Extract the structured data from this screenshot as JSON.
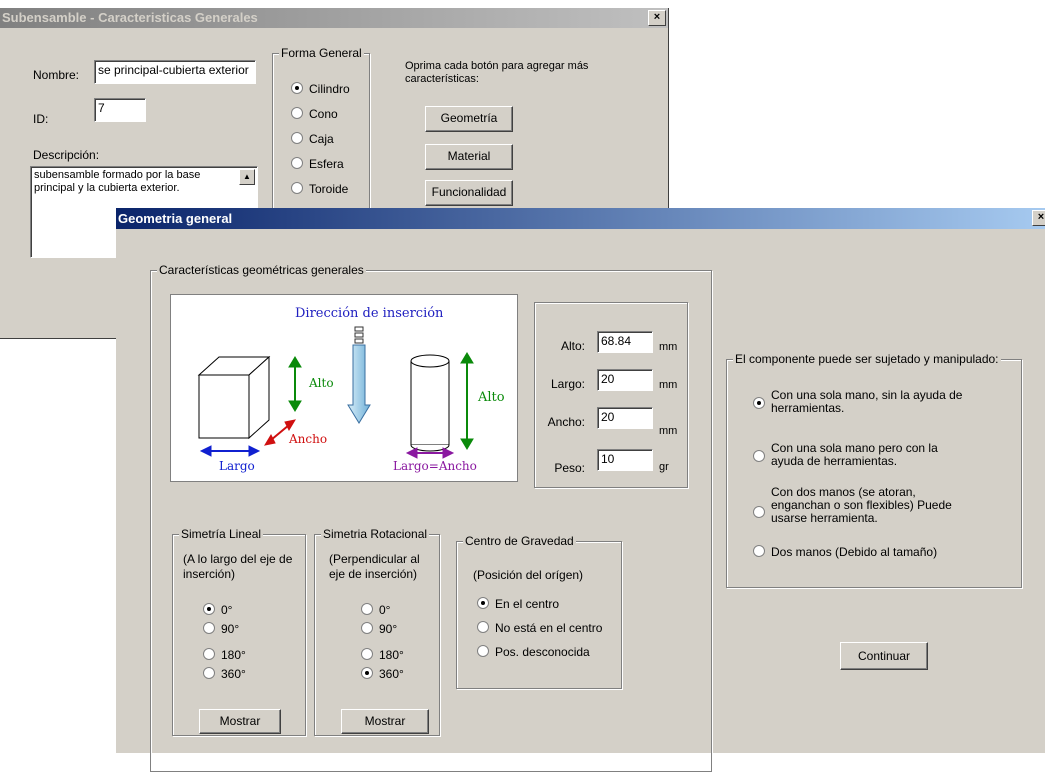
{
  "win1": {
    "title": "Subensamble - Caracteristicas Generales",
    "close": "×",
    "nombre_label": "Nombre:",
    "nombre_value": "se principal-cubierta exterior",
    "id_label": "ID:",
    "id_value": "7",
    "desc_label": "Descripción:",
    "desc_value": "subensamble formado por la base principal y la cubierta exterior.",
    "forma_legend": "Forma General",
    "forma_options": [
      "Cilindro",
      "Cono",
      "Caja",
      "Esfera",
      "Toroide"
    ],
    "hint": "Oprima cada botón para agregar más características:",
    "buttons": [
      "Geometría",
      "Material",
      "Funcionalidad"
    ]
  },
  "win2": {
    "title": "Geometria general",
    "close": "×",
    "caract_legend": "Características geométricas generales",
    "diagram": {
      "direccion": "Dirección de inserción",
      "alto1": "Alto",
      "ancho": "Ancho",
      "largo": "Largo",
      "alto2": "Alto",
      "largo_ancho": "Largo=Ancho"
    },
    "dims": {
      "alto_label": "Alto:",
      "alto_value": "68.84",
      "alto_unit": "mm",
      "largo_label": "Largo:",
      "largo_value": "20",
      "largo_unit": "mm",
      "ancho_label": "Ancho:",
      "ancho_value": "20",
      "ancho_unit": "mm",
      "peso_label": "Peso:",
      "peso_value": "10",
      "peso_unit": "gr"
    },
    "sim_lineal": {
      "legend": "Simetría Lineal",
      "desc": "(A lo largo del eje de inserción)",
      "options": [
        "0°",
        "90°",
        "180°",
        "360°"
      ],
      "selected": 0,
      "button": "Mostrar"
    },
    "sim_rot": {
      "legend": "Simetria Rotacional",
      "desc": "(Perpendicular al eje de inserción)",
      "options": [
        "0°",
        "90°",
        "180°",
        "360°"
      ],
      "selected": 3,
      "button": "Mostrar"
    },
    "gravedad": {
      "legend": "Centro de Gravedad",
      "desc": "(Posición del orígen)",
      "options": [
        "En el centro",
        "No está en el centro",
        "Pos. desconocida"
      ],
      "selected": 0
    },
    "manip": {
      "legend": "El componente puede ser sujetado y manipulado:",
      "options": [
        "Con una sola mano, sin la ayuda de herramientas.",
        "Con una sola mano pero con la ayuda de herramientas.",
        "Con dos manos (se atoran, enganchan o son flexibles) Puede usarse herramienta.",
        "Dos manos (Debido al tamaño)"
      ],
      "selected": 0
    },
    "continuar": "Continuar"
  }
}
